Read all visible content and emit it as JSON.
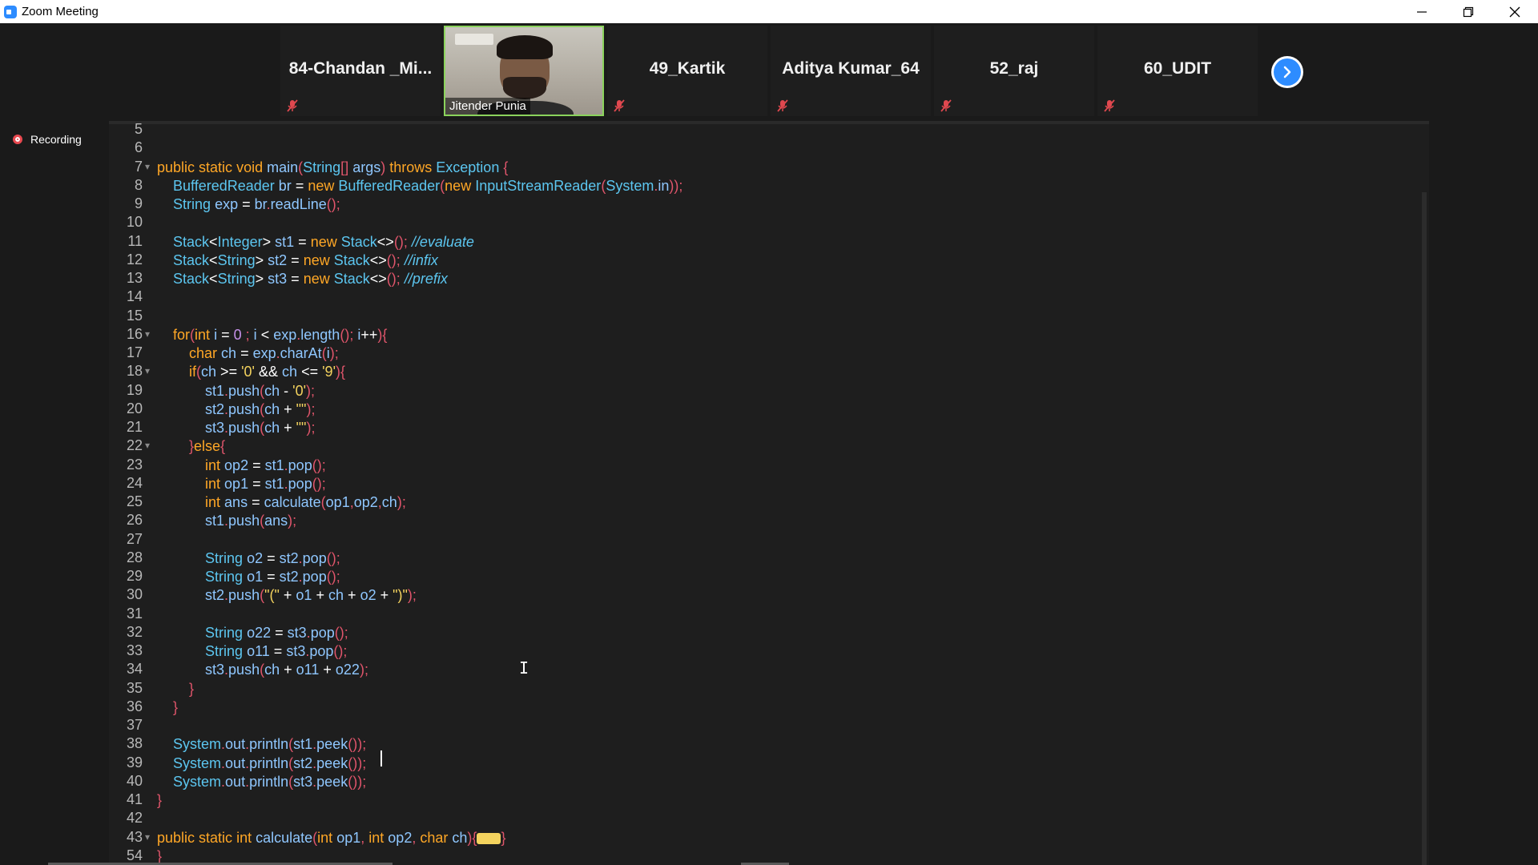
{
  "window": {
    "title": "Zoom Meeting"
  },
  "participants": [
    {
      "name": "84-Chandan _Mi...",
      "muted": true
    },
    {
      "name": "Jitender Punia",
      "video": true
    },
    {
      "name": "49_Kartik",
      "muted": true
    },
    {
      "name": "Aditya Kumar_64",
      "muted": true
    },
    {
      "name": "52_raj",
      "muted": true
    },
    {
      "name": "60_UDIT",
      "muted": true
    }
  ],
  "recording": {
    "label": "Recording"
  },
  "editor": {
    "lines": [
      {
        "n": "5",
        "t": ""
      },
      {
        "n": "6",
        "t": ""
      },
      {
        "n": "7",
        "t": "public static void main(String[] args) throws Exception {",
        "fold": true
      },
      {
        "n": "8",
        "t": "    BufferedReader br = new BufferedReader(new InputStreamReader(System.in));"
      },
      {
        "n": "9",
        "t": "    String exp = br.readLine();"
      },
      {
        "n": "10",
        "t": ""
      },
      {
        "n": "11",
        "t": "    Stack<Integer> st1 = new Stack<>(); //evaluate"
      },
      {
        "n": "12",
        "t": "    Stack<String> st2 = new Stack<>(); //infix"
      },
      {
        "n": "13",
        "t": "    Stack<String> st3 = new Stack<>(); //prefix"
      },
      {
        "n": "14",
        "t": ""
      },
      {
        "n": "15",
        "t": ""
      },
      {
        "n": "16",
        "t": "    for(int i = 0 ; i < exp.length(); i++){",
        "fold": true
      },
      {
        "n": "17",
        "t": "        char ch = exp.charAt(i);"
      },
      {
        "n": "18",
        "t": "        if(ch >= '0' && ch <= '9'){",
        "fold": true
      },
      {
        "n": "19",
        "t": "            st1.push(ch - '0');"
      },
      {
        "n": "20",
        "t": "            st2.push(ch + \"\");"
      },
      {
        "n": "21",
        "t": "            st3.push(ch + \"\");"
      },
      {
        "n": "22",
        "t": "        }else{",
        "fold": true
      },
      {
        "n": "23",
        "t": "            int op2 = st1.pop();"
      },
      {
        "n": "24",
        "t": "            int op1 = st1.pop();"
      },
      {
        "n": "25",
        "t": "            int ans = calculate(op1,op2,ch);"
      },
      {
        "n": "26",
        "t": "            st1.push(ans);"
      },
      {
        "n": "27",
        "t": ""
      },
      {
        "n": "28",
        "t": "            String o2 = st2.pop();"
      },
      {
        "n": "29",
        "t": "            String o1 = st2.pop();"
      },
      {
        "n": "30",
        "t": "            st2.push(\"(\" + o1 + ch + o2 + \")\");"
      },
      {
        "n": "31",
        "t": ""
      },
      {
        "n": "32",
        "t": "            String o22 = st3.pop();"
      },
      {
        "n": "33",
        "t": "            String o11 = st3.pop();"
      },
      {
        "n": "34",
        "t": "            st3.push(ch + o11 + o22);"
      },
      {
        "n": "35",
        "t": "        }"
      },
      {
        "n": "36",
        "t": "    }"
      },
      {
        "n": "37",
        "t": ""
      },
      {
        "n": "38",
        "t": "    System.out.println(st1.peek());"
      },
      {
        "n": "39",
        "t": "    System.out.println(st2.peek());"
      },
      {
        "n": "40",
        "t": "    System.out.println(st3.peek());"
      },
      {
        "n": "41",
        "t": "}"
      },
      {
        "n": "42",
        "t": ""
      },
      {
        "n": "43",
        "t": "public static int calculate(int op1, int op2, char ch){",
        "fold": true,
        "collapsed": true
      },
      {
        "n": "54",
        "t": "}"
      }
    ]
  },
  "colors": {
    "keyword": "#ffa726",
    "class": "#5cc6f0",
    "identifier": "#8fc7ff",
    "punctuation": "#e0556b",
    "number": "#c792ea",
    "string": "#f4d35e",
    "comment": "#5cc6f0"
  }
}
